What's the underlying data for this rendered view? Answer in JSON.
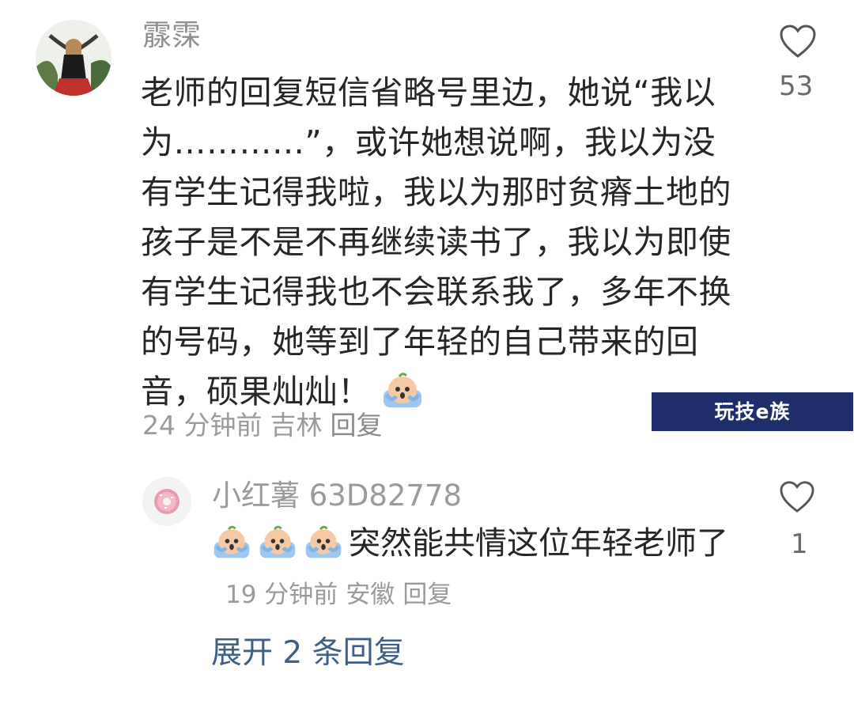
{
  "comment": {
    "username": "霡霂",
    "text": "老师的回复短信省略号里边，她说“我以为…………”，或许她想说啊，我以为没有学生记得我啦，我以为那时贫瘠土地的孩子是不是不再继续读书了，我以为即使有学生记得我也不会联系我了，多年不换的号码，她等到了年轻的自己带来的回音，硕果灿灿！",
    "emoji": "crying-emoji",
    "time": "24 分钟前",
    "location": "吉林",
    "reply_label": "回复",
    "likes": "53"
  },
  "reply": {
    "username": "小红薯 63D82778",
    "text": "突然能共情这位年轻老师了",
    "emoji_count": 3,
    "time": "19 分钟前",
    "location": "安徽",
    "reply_label": "回复",
    "likes": "1"
  },
  "expand_label": "展开 2 条回复",
  "watermark": "玩技e族",
  "colors": {
    "username": "#8f8f8f",
    "body": "#262626",
    "meta": "#9a9a9a",
    "expand": "#3f5f86",
    "watermark_bg": "#1f2f6b"
  }
}
